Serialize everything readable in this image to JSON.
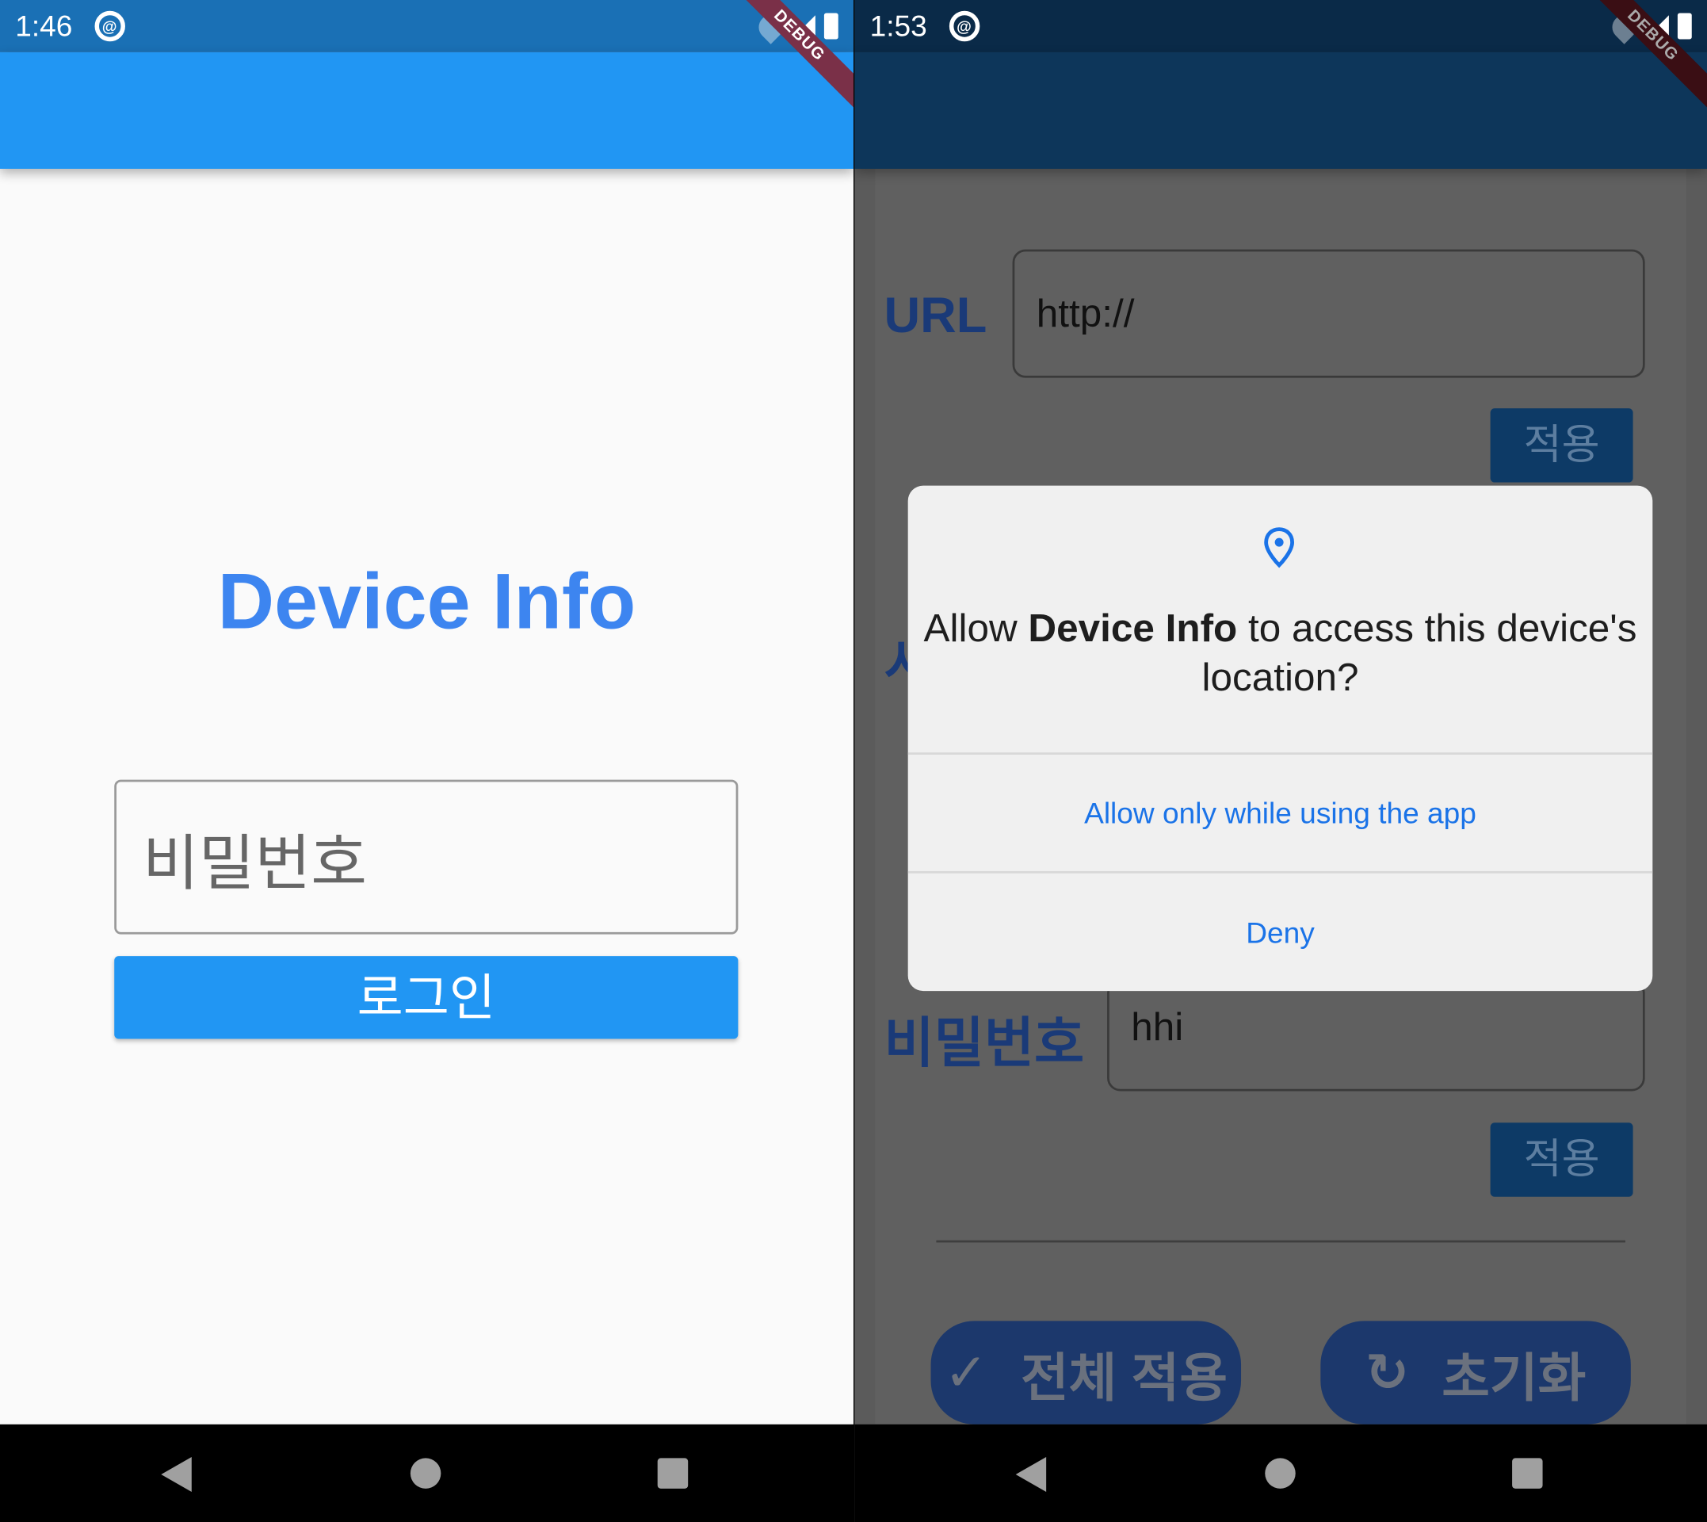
{
  "left": {
    "status": {
      "time": "1:46"
    },
    "debug_banner": "DEBUG",
    "title": "Device Info",
    "password_placeholder": "비밀번호",
    "login_label": "로그인",
    "colors": {
      "appbar": "#2196F3",
      "status": "#1A70B5",
      "title": "#3D85F0"
    }
  },
  "right": {
    "status": {
      "time": "1:53"
    },
    "debug_banner": "DEBUG",
    "url_label": "URL",
    "url_value": "http://",
    "apply_label": "적용",
    "hidden_label": "시",
    "password_label": "비밀번호",
    "password_value": "hhi",
    "apply_label_2": "적용",
    "apply_all_label": "전체 적용",
    "reset_label": "초기화",
    "dialog": {
      "icon": "location-pin-icon",
      "prefix": "Allow ",
      "app_name": "Device Info",
      "suffix": " to access this device's location?",
      "allow_label": "Allow only while using the app",
      "deny_label": "Deny"
    }
  }
}
